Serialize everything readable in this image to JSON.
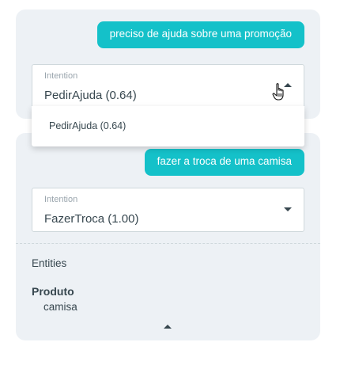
{
  "messages": [
    {
      "user_text": "preciso de ajuda sobre uma promoção",
      "intention": {
        "label": "Intention",
        "value": "PedirAjuda (0.64)",
        "expanded": true,
        "options": [
          "PedirAjuda (0.64)"
        ]
      }
    },
    {
      "user_text": "fazer a troca de uma camisa",
      "intention": {
        "label": "Intention",
        "value": "FazerTroca (1.00)",
        "expanded": false
      },
      "entities": {
        "heading": "Entities",
        "items": [
          {
            "name": "Produto",
            "value": "camisa"
          }
        ]
      }
    }
  ],
  "colors": {
    "bubble": "#14c1c9",
    "card": "#edf1f5",
    "text": "#37474f",
    "label": "#9aa5ad"
  },
  "icons": [
    "caret-up-icon",
    "caret-down-icon",
    "hand-pointer-cursor-icon"
  ]
}
